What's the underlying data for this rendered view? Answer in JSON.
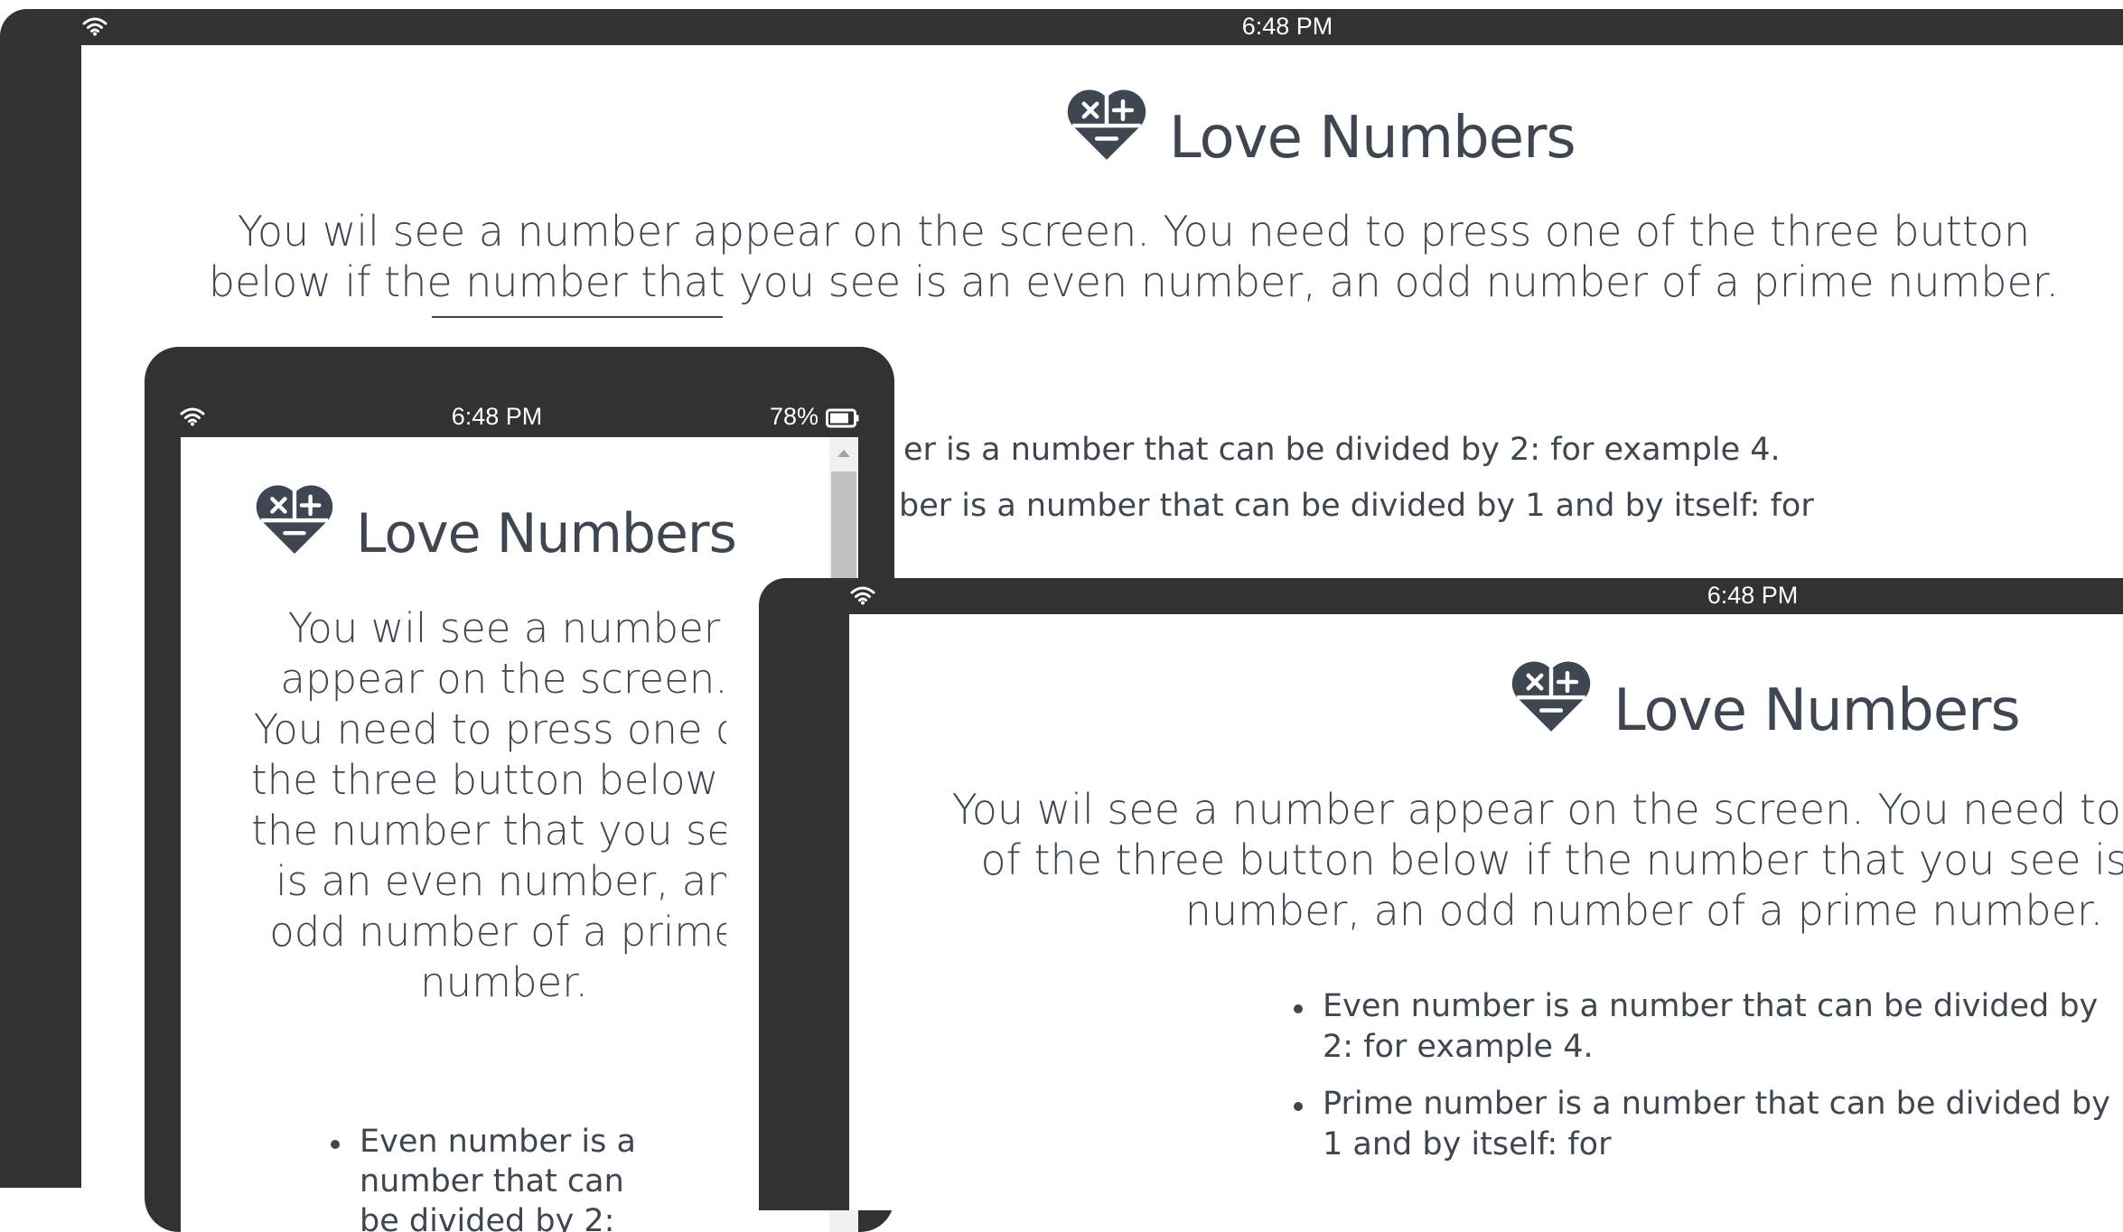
{
  "status": {
    "time": "6:48 PM",
    "battery": "78%"
  },
  "app": {
    "title": "Love Numbers",
    "intro": "You wil see a number appear on the screen. You need to press one of the three button below if the number that you see is an even number, an odd number of a prime number.",
    "rules": [
      "Even number is a number that can be divided by 2: for example 4.",
      "Prime number is a number that can be divided by 1 and by itself: for"
    ]
  },
  "large_view": {
    "rule_1_visible": "er is a number that can be divided by 2: for example 4.",
    "rule_2_visible": "ber is a number that can be divided by 1 and by itself: for"
  },
  "colors": {
    "bezel": "#323232",
    "text": "#3d4651",
    "screen": "#ffffff"
  },
  "icons": [
    "wifi-icon",
    "battery-icon",
    "love-numbers-logo-icon",
    "scroll-up-arrow-icon"
  ]
}
